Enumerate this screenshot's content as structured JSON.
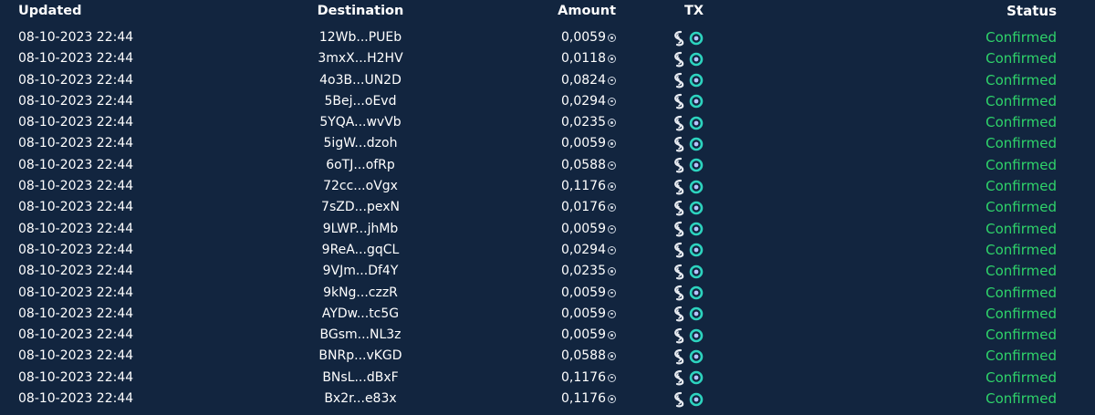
{
  "headers": {
    "updated": "Updated",
    "destination": "Destination",
    "amount": "Amount",
    "tx": "TX",
    "status": "Status"
  },
  "colors": {
    "background": "#12253f",
    "confirmed": "#2fd36a",
    "explorer_icon": "#2dd4bf"
  },
  "icons": {
    "currency": "sol-coin-icon",
    "tx_explorer_1": "solscan-icon",
    "tx_explorer_2": "solana-fm-icon"
  },
  "rows": [
    {
      "updated": "08-10-2023 22:44",
      "destination": "12Wb...PUEb",
      "amount": "0,0059",
      "status": "Confirmed"
    },
    {
      "updated": "08-10-2023 22:44",
      "destination": "3mxX...H2HV",
      "amount": "0,0118",
      "status": "Confirmed"
    },
    {
      "updated": "08-10-2023 22:44",
      "destination": "4o3B...UN2D",
      "amount": "0,0824",
      "status": "Confirmed"
    },
    {
      "updated": "08-10-2023 22:44",
      "destination": "5Bej...oEvd",
      "amount": "0,0294",
      "status": "Confirmed"
    },
    {
      "updated": "08-10-2023 22:44",
      "destination": "5YQA...wvVb",
      "amount": "0,0235",
      "status": "Confirmed"
    },
    {
      "updated": "08-10-2023 22:44",
      "destination": "5igW...dzoh",
      "amount": "0,0059",
      "status": "Confirmed"
    },
    {
      "updated": "08-10-2023 22:44",
      "destination": "6oTJ...ofRp",
      "amount": "0,0588",
      "status": "Confirmed"
    },
    {
      "updated": "08-10-2023 22:44",
      "destination": "72cc...oVgx",
      "amount": "0,1176",
      "status": "Confirmed"
    },
    {
      "updated": "08-10-2023 22:44",
      "destination": "7sZD...pexN",
      "amount": "0,0176",
      "status": "Confirmed"
    },
    {
      "updated": "08-10-2023 22:44",
      "destination": "9LWP...jhMb",
      "amount": "0,0059",
      "status": "Confirmed"
    },
    {
      "updated": "08-10-2023 22:44",
      "destination": "9ReA...gqCL",
      "amount": "0,0294",
      "status": "Confirmed"
    },
    {
      "updated": "08-10-2023 22:44",
      "destination": "9VJm...Df4Y",
      "amount": "0,0235",
      "status": "Confirmed"
    },
    {
      "updated": "08-10-2023 22:44",
      "destination": "9kNg...czzR",
      "amount": "0,0059",
      "status": "Confirmed"
    },
    {
      "updated": "08-10-2023 22:44",
      "destination": "AYDw...tc5G",
      "amount": "0,0059",
      "status": "Confirmed"
    },
    {
      "updated": "08-10-2023 22:44",
      "destination": "BGsm...NL3z",
      "amount": "0,0059",
      "status": "Confirmed"
    },
    {
      "updated": "08-10-2023 22:44",
      "destination": "BNRp...vKGD",
      "amount": "0,0588",
      "status": "Confirmed"
    },
    {
      "updated": "08-10-2023 22:44",
      "destination": "BNsL...dBxF",
      "amount": "0,1176",
      "status": "Confirmed"
    },
    {
      "updated": "08-10-2023 22:44",
      "destination": "Bx2r...e83x",
      "amount": "0,1176",
      "status": "Confirmed"
    }
  ]
}
